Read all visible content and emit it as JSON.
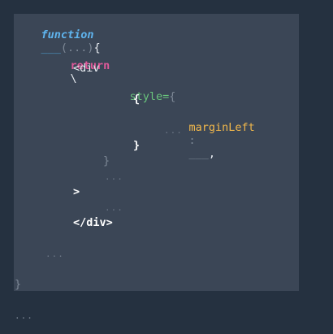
{
  "code": {
    "keyword_function": "function",
    "blank_1": "___",
    "params": "(...)",
    "open_brace": "{",
    "return_kw": "return",
    "backslash": "\\",
    "div_open": "<div",
    "style_attr": "style=",
    "style_open_brace": "{",
    "inner_open_brace": "{",
    "margin_prop": "marginLeft",
    "colon": ":",
    "blank_2": "___",
    "comma": ",",
    "dots_inner": "...",
    "inner_close_brace": "}",
    "style_close_brace": "}",
    "dots_after_style": "...",
    "tag_close": ">",
    "dots_children": "...",
    "div_close": "</div>",
    "dots_after_return": "...",
    "func_close_brace": "}"
  },
  "outer_dots": "..."
}
